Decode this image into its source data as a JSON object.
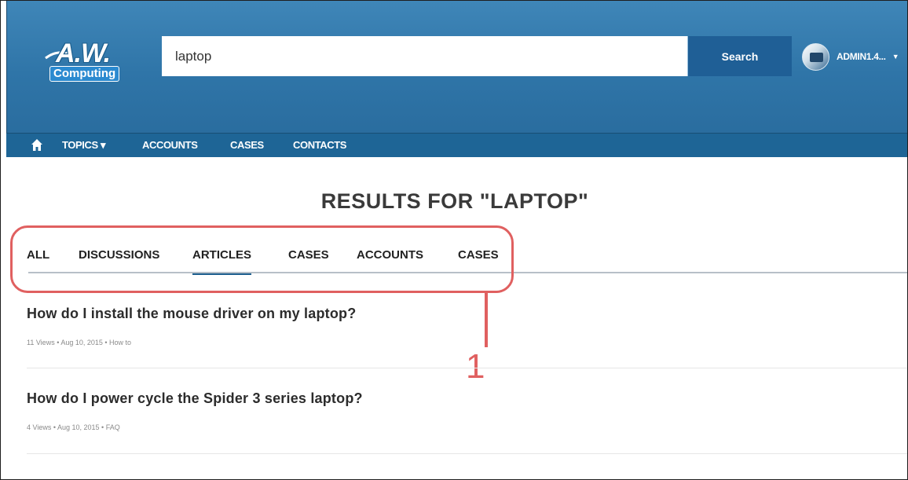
{
  "header": {
    "logo": {
      "text": "A.W.",
      "subtext": "Computing"
    },
    "search": {
      "value": "laptop",
      "placeholder": "",
      "button_label": "Search"
    },
    "user": {
      "name": "ADMIN1.4...",
      "caret": "▼"
    }
  },
  "nav": {
    "home_icon": "home-icon",
    "items": [
      {
        "label": "TOPICS ▾"
      },
      {
        "label": "ACCOUNTS"
      },
      {
        "label": "CASES"
      },
      {
        "label": "CONTACTS"
      }
    ]
  },
  "results": {
    "title": "RESULTS FOR \"LAPTOP\"",
    "tabs": [
      {
        "label": "ALL",
        "active": false
      },
      {
        "label": "DISCUSSIONS",
        "active": false
      },
      {
        "label": "ARTICLES",
        "active": true
      },
      {
        "label": "CASES",
        "active": false
      },
      {
        "label": "ACCOUNTS",
        "active": false
      },
      {
        "label": "CASES",
        "active": false
      }
    ],
    "items": [
      {
        "title": "How do I install the mouse driver on my laptop?",
        "meta": "11 Views • Aug 10, 2015 • How to"
      },
      {
        "title": "How do I power cycle the Spider 3 series laptop?",
        "meta": "4 Views • Aug 10, 2015 • FAQ"
      }
    ]
  },
  "annotation": {
    "number": "1",
    "color": "#e06060"
  },
  "colors": {
    "header": "#2f75a8",
    "navbar": "#1e6596",
    "search_button": "#1f5f96",
    "active_tab": "#1d5f8e"
  }
}
